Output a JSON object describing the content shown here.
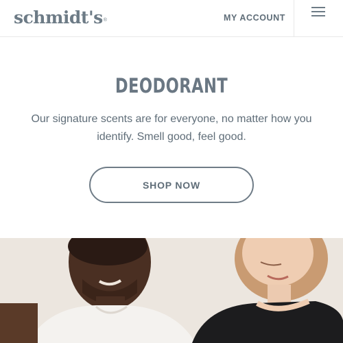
{
  "header": {
    "logo": "schmidt's",
    "logo_mark": "®",
    "account_label": "MY ACCOUNT",
    "menu_icon": "hamburger-menu-icon"
  },
  "hero": {
    "title": "DEODORANT",
    "description": "Our signature scents are for everyone, no matter how you identify. Smell good, feel good.",
    "cta_label": "SHOP NOW"
  },
  "colors": {
    "text": "#5f6d78",
    "border": "#6f7c87",
    "background": "#ffffff"
  }
}
